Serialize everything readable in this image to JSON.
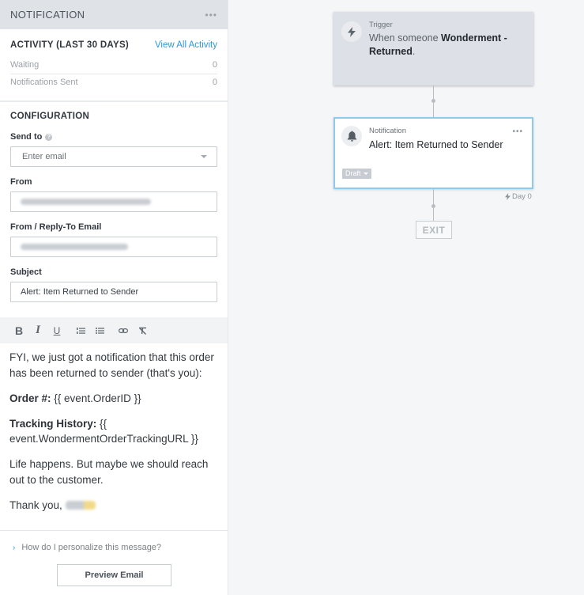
{
  "panel": {
    "title": "NOTIFICATION",
    "menu_icon": "more-horizontal-icon",
    "activity": {
      "title": "ACTIVITY (LAST 30 DAYS)",
      "view_all_label": "View All Activity",
      "stats": [
        {
          "label": "Waiting",
          "value": "0"
        },
        {
          "label": "Notifications Sent",
          "value": "0"
        }
      ]
    },
    "configuration": {
      "title": "CONFIGURATION",
      "send_to": {
        "label": "Send to",
        "placeholder": "Enter email",
        "help_icon": "question-circle-icon"
      },
      "from": {
        "label": "From",
        "value": "[redacted]"
      },
      "reply_to": {
        "label": "From / Reply-To Email",
        "value": "[redacted]"
      },
      "subject": {
        "label": "Subject",
        "value": "Alert: Item Returned to Sender"
      }
    },
    "toolbar": [
      "bold-icon",
      "italic-icon",
      "underline-icon",
      "ordered-list-icon",
      "unordered-list-icon",
      "link-icon",
      "clear-formatting-icon"
    ],
    "body": {
      "intro": "FYI, we just got a notification that this order has been returned to sender (that's you):",
      "order_label": "Order #:",
      "order_value": " {{ event.OrderID }}",
      "tracking_label": "Tracking History:",
      "tracking_value": " {{ event.WondermentOrderTrackingURL }}",
      "closing": "Life happens. But maybe we should reach out to the customer.",
      "signoff": "Thank you, "
    },
    "help_link": "How do I personalize this message?",
    "preview_button": "Preview Email"
  },
  "canvas": {
    "trigger": {
      "kicker": "Trigger",
      "text_prefix": "When someone ",
      "text_bold": "Wonderment - Returned",
      "text_suffix": "."
    },
    "notification": {
      "kicker": "Notification",
      "title": "Alert: Item Returned to Sender",
      "status": "Draft"
    },
    "delay_label": "Day 0",
    "exit_label": "EXIT"
  },
  "colors": {
    "accent": "#2a9ad9",
    "selected_border": "#8ccbee",
    "header_bg": "#dfe3e8"
  }
}
